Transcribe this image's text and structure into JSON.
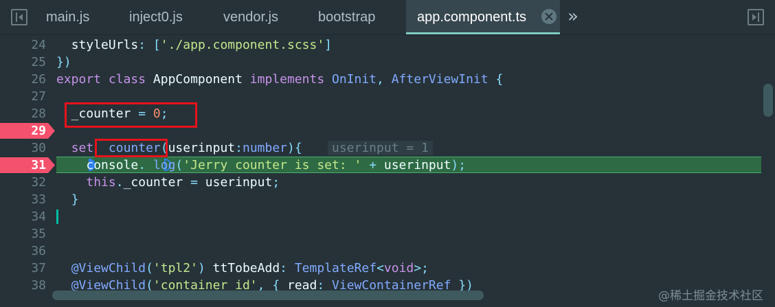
{
  "tabs": [
    {
      "label": "main.js",
      "active": false
    },
    {
      "label": "inject0.js",
      "active": false
    },
    {
      "label": "vendor.js",
      "active": false
    },
    {
      "label": "bootstrap",
      "active": false
    },
    {
      "label": "app.component.ts",
      "active": true
    }
  ],
  "overflow_glyph": "»",
  "colors": {
    "background": "#263238",
    "active_tab": "#37474f",
    "breakpoint": "#ff5370",
    "execution_line": "#2e6a43",
    "annotation_box": "#e8121b"
  },
  "icons": {
    "nav_left": "panel-left-icon",
    "nav_right": "panel-right-icon",
    "tab_close": "close-icon",
    "overflow": "chevrons-right-icon"
  },
  "breakpoint_lines": [
    29,
    31
  ],
  "current_line": 31,
  "lines": [
    {
      "num": "24",
      "code": "  styleUrls: ['./app.component.scss']"
    },
    {
      "num": "25",
      "code": "})"
    },
    {
      "num": "26",
      "code": "export class AppComponent implements OnInit, AfterViewInit {"
    },
    {
      "num": "27",
      "code": ""
    },
    {
      "num": "28",
      "code": "  _counter = 0;"
    },
    {
      "num": "29",
      "code": ""
    },
    {
      "num": "30",
      "code": "  set  counter(userinput:number){"
    },
    {
      "num": "31",
      "code": "    console. log('Jerry counter is set: ' + userinput);"
    },
    {
      "num": "32",
      "code": "    this._counter = userinput;"
    },
    {
      "num": "33",
      "code": "  }"
    },
    {
      "num": "34",
      "code": ""
    },
    {
      "num": "35",
      "code": ""
    },
    {
      "num": "36",
      "code": ""
    },
    {
      "num": "37",
      "code": "  @ViewChild('tpl2') ttTobeAdd: TemplateRef<void>;"
    },
    {
      "num": "38",
      "code": "  @ViewChild('container_id', { read: ViewContainerRef })"
    }
  ],
  "inline_value": "userinput = 1",
  "watermark": "@稀土掘金技术社区"
}
